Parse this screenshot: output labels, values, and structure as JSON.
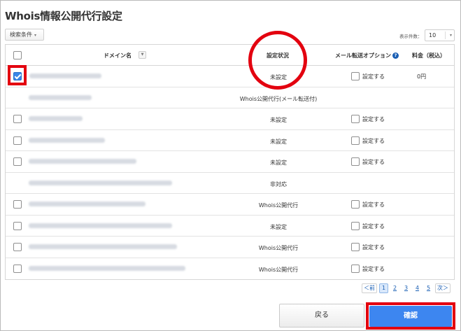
{
  "page_title": "Whois情報公開代行設定",
  "search_conditions": {
    "label": "検索条件",
    "caret": "▾"
  },
  "per_page": {
    "label": "表示件数：",
    "value": "10",
    "caret": "▾"
  },
  "table": {
    "headers": {
      "domain": "ドメイン名",
      "sort_icon": "sort-down-icon",
      "status": "設定状況",
      "mail_option": "メール転送オプション",
      "help_icon": "help-circle-icon",
      "price": "料金（税込）"
    },
    "rows": [
      {
        "domain": "",
        "blur_width": 0.16,
        "has_checkbox": true,
        "checked": true,
        "status": "未設定",
        "option_label": "設定する",
        "has_option": true,
        "price": "0円"
      },
      {
        "domain": "",
        "blur_width": 0.14,
        "has_checkbox": false,
        "checked": false,
        "status": "Whois公開代行(メール転送付)",
        "option_label": "",
        "has_option": false,
        "price": ""
      },
      {
        "domain": "",
        "blur_width": 0.12,
        "has_checkbox": true,
        "checked": false,
        "status": "未設定",
        "option_label": "設定する",
        "has_option": true,
        "price": ""
      },
      {
        "domain": "",
        "blur_width": 0.17,
        "has_checkbox": true,
        "checked": false,
        "status": "未設定",
        "option_label": "設定する",
        "has_option": true,
        "price": ""
      },
      {
        "domain": "",
        "blur_width": 0.24,
        "has_checkbox": true,
        "checked": false,
        "status": "未設定",
        "option_label": "設定する",
        "has_option": true,
        "price": ""
      },
      {
        "domain": "",
        "blur_width": 0.32,
        "has_checkbox": false,
        "checked": false,
        "status": "非対応",
        "option_label": "",
        "has_option": false,
        "price": ""
      },
      {
        "domain": "",
        "blur_width": 0.26,
        "has_checkbox": true,
        "checked": false,
        "status": "Whois公開代行",
        "option_label": "設定する",
        "has_option": true,
        "price": ""
      },
      {
        "domain": "",
        "blur_width": 0.32,
        "has_checkbox": true,
        "checked": false,
        "status": "未設定",
        "option_label": "設定する",
        "has_option": true,
        "price": ""
      },
      {
        "domain": "",
        "blur_width": 0.33,
        "has_checkbox": true,
        "checked": false,
        "status": "Whois公開代行",
        "option_label": "設定する",
        "has_option": true,
        "price": ""
      },
      {
        "domain": "",
        "blur_width": 0.35,
        "has_checkbox": true,
        "checked": false,
        "status": "Whois公開代行",
        "option_label": "設定する",
        "has_option": true,
        "price": ""
      }
    ]
  },
  "pagination": {
    "prev": "＜前",
    "pages": [
      "1",
      "2",
      "3",
      "4",
      "5"
    ],
    "current": "1",
    "next": "次＞"
  },
  "buttons": {
    "back": "戻る",
    "confirm": "確認"
  },
  "colors": {
    "accent": "#3d86f0",
    "highlight": "#e3000f",
    "checkbox_checked": "#3a86e8"
  }
}
